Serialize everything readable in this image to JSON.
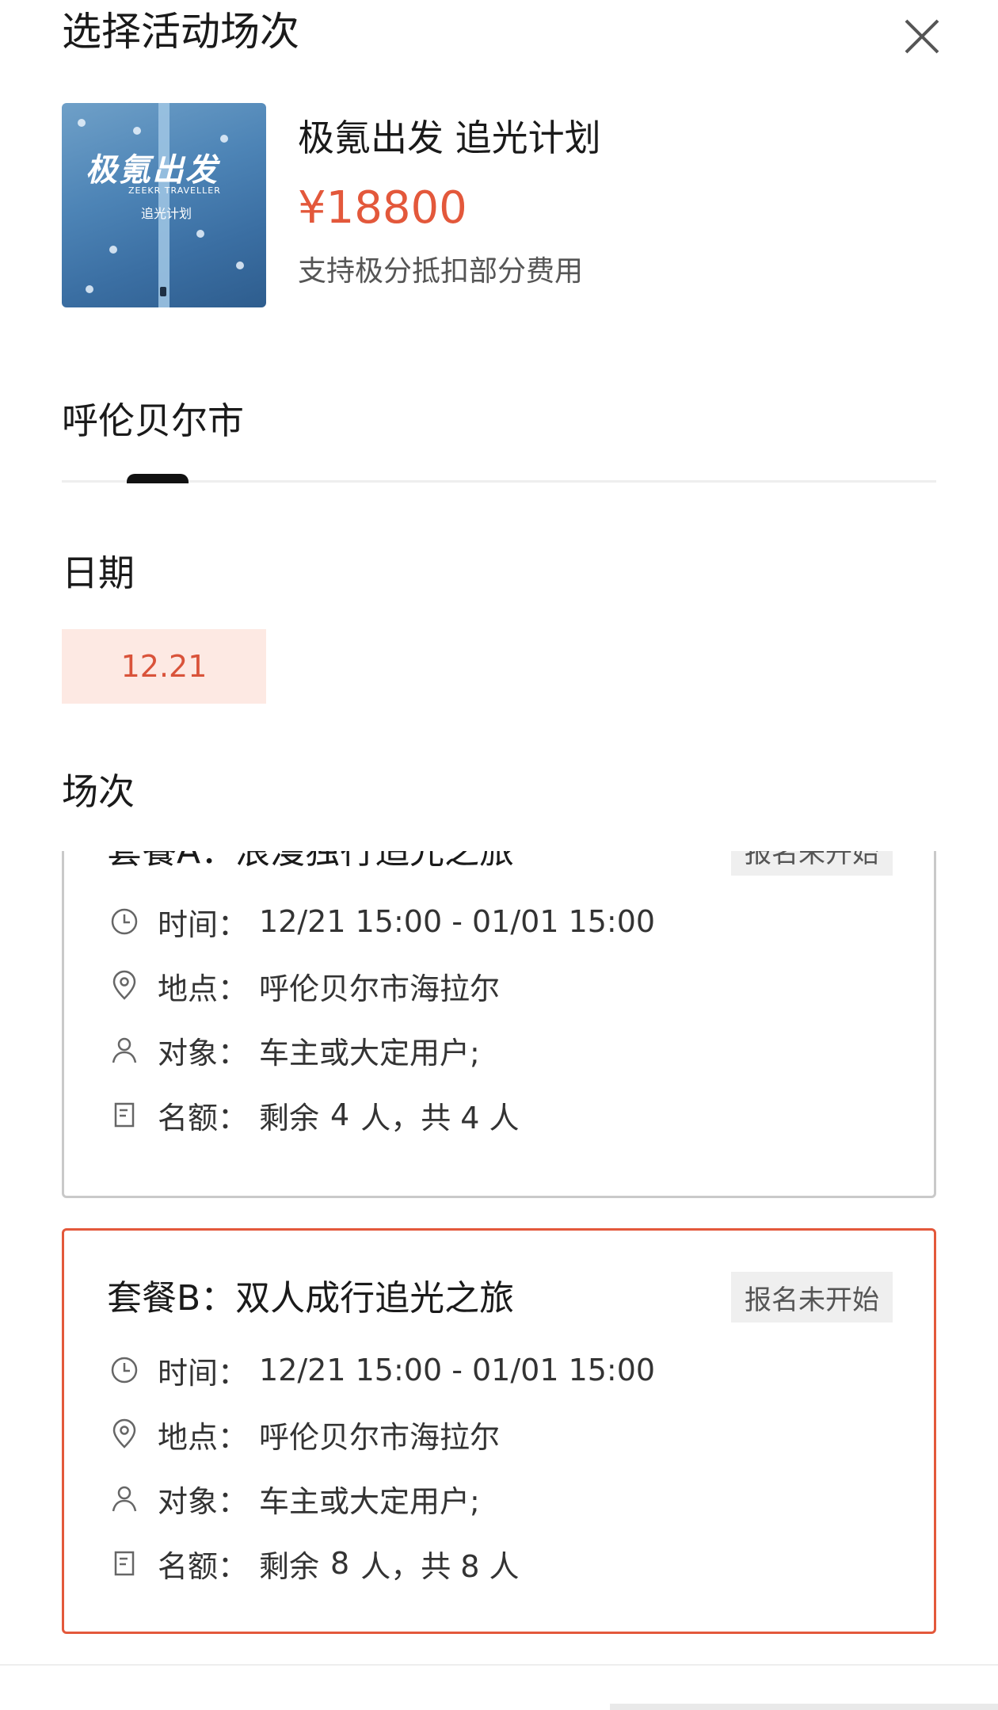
{
  "header": {
    "title": "选择活动场次",
    "close_icon": "close-icon"
  },
  "product": {
    "image_title": "极氪出发",
    "image_subtitle": "ZEEKR TRAVELLER",
    "image_plan": "追光计划",
    "name": "极氪出发 追光计划",
    "price": "¥18800",
    "note": "支持极分抵扣部分费用"
  },
  "city": {
    "label": "呼伦贝尔市"
  },
  "date": {
    "heading": "日期",
    "options": [
      "12.21"
    ],
    "selected": "12.21"
  },
  "sessions": {
    "heading": "场次",
    "items": [
      {
        "title": "套餐A：浪漫独行追光之旅",
        "status": "报名未开始",
        "time_label": "时间：",
        "time_value": "12/21 15:00 - 01/01 15:00",
        "place_label": "地点：",
        "place_value": "呼伦贝尔市海拉尔",
        "target_label": "对象：",
        "target_value": "车主或大定用户;",
        "quota_label": "名额：",
        "quota_pre": "剩余",
        "quota_remaining": "4",
        "quota_post": "人，共 4 人"
      },
      {
        "title": "套餐B：双人成行追光之旅",
        "status": "报名未开始",
        "time_label": "时间：",
        "time_value": "12/21 15:00 - 01/01 15:00",
        "place_label": "地点：",
        "place_value": "呼伦贝尔市海拉尔",
        "target_label": "对象：",
        "target_value": "车主或大定用户;",
        "quota_label": "名额：",
        "quota_pre": "剩余",
        "quota_remaining": "8",
        "quota_post": "人，共 8 人"
      }
    ]
  },
  "colors": {
    "accent": "#e3583b",
    "chip_bg": "#fde9e3",
    "badge_bg": "#efefef",
    "border": "#c9c9c9"
  },
  "icons": [
    "close-icon",
    "clock-icon",
    "location-pin-icon",
    "person-icon",
    "document-icon"
  ]
}
